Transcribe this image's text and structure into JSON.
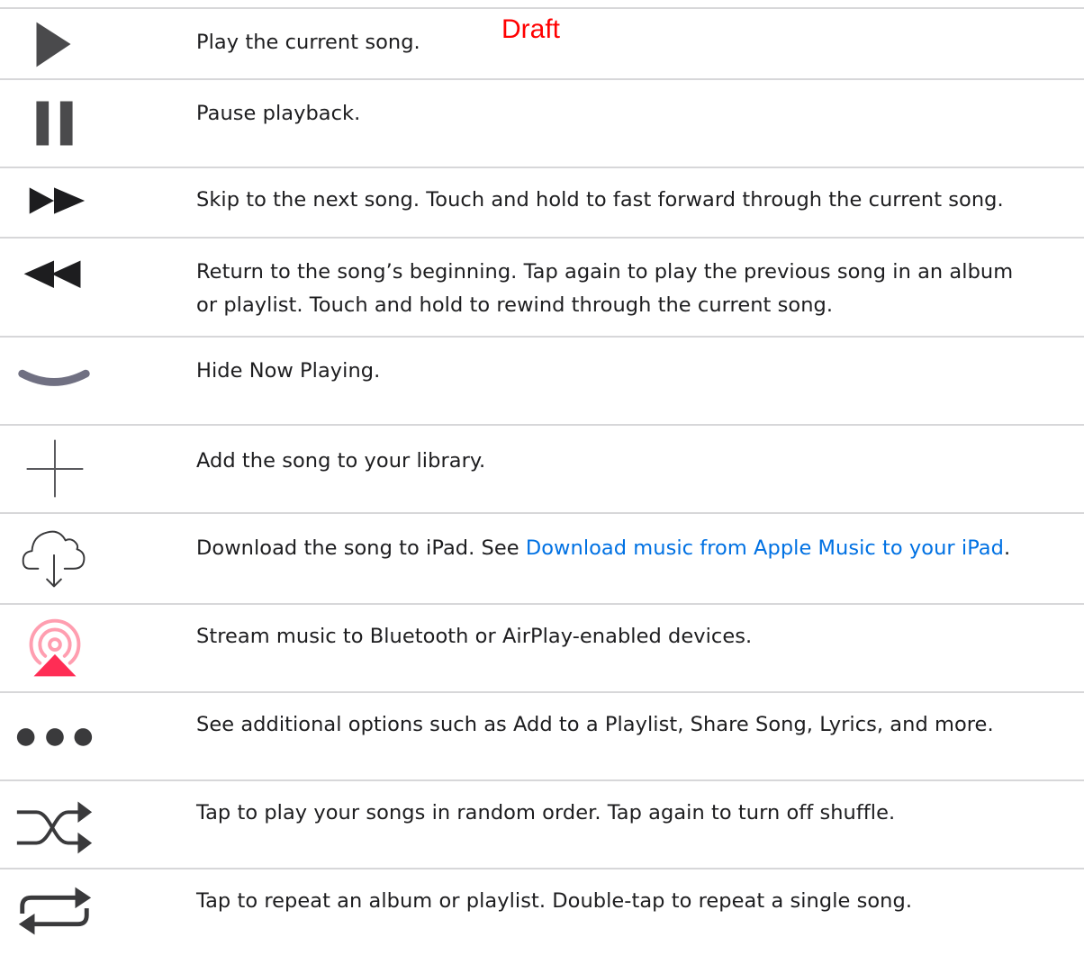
{
  "watermark": "Draft",
  "colors": {
    "icon_dark": "#4a4a4c",
    "icon_gray": "#6e6e73",
    "chevron": "#707082",
    "airplay_red": "#ff2d55",
    "airplay_ring": "#ff9eb0",
    "link": "#0071e3",
    "divider": "#d7d7d9"
  },
  "rows": [
    {
      "icon": "play-icon",
      "text": "Play the current song."
    },
    {
      "icon": "pause-icon",
      "text": "Pause playback."
    },
    {
      "icon": "fast-forward-icon",
      "text": "Skip to the next song. Touch and hold to fast forward through the current song."
    },
    {
      "icon": "rewind-icon",
      "line1": "Return to the song’s beginning. Tap again to play the previous song in an album",
      "line2": "or playlist. Touch and hold to rewind through the current song."
    },
    {
      "icon": "chevron-down-icon",
      "text": "Hide Now Playing."
    },
    {
      "icon": "plus-icon",
      "text": "Add the song to your library."
    },
    {
      "icon": "cloud-download-icon",
      "text_before": "Download the song to iPad. See ",
      "link": "Download music from Apple Music to your iPad",
      "text_after": "."
    },
    {
      "icon": "airplay-icon",
      "text": "Stream music to Bluetooth or AirPlay-enabled devices."
    },
    {
      "icon": "more-icon",
      "text": "See additional options such as Add to a Playlist, Share Song, Lyrics, and more."
    },
    {
      "icon": "shuffle-icon",
      "text": "Tap to play your songs in random order. Tap again to turn off shuffle."
    },
    {
      "icon": "repeat-icon",
      "text": "Tap to repeat an album or playlist. Double-tap to repeat a single song."
    }
  ]
}
